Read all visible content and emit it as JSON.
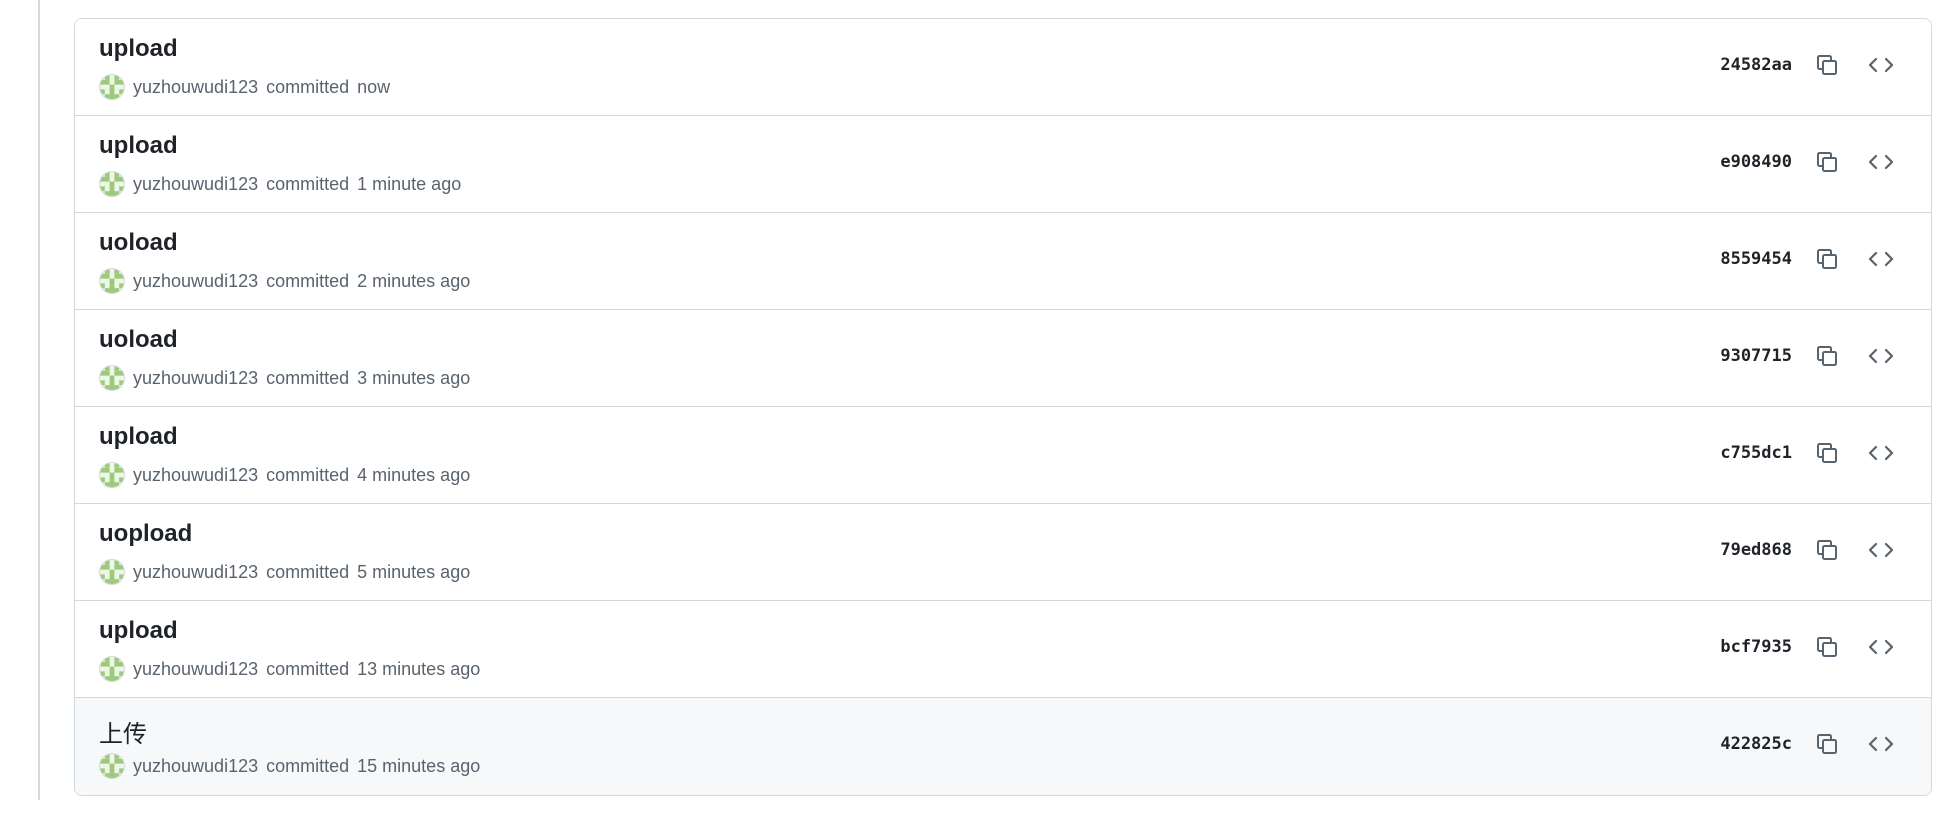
{
  "commits": [
    {
      "title": "upload",
      "author": "yuzhouwudi123",
      "action": "committed",
      "time": "now",
      "sha": "24582aa"
    },
    {
      "title": "upload",
      "author": "yuzhouwudi123",
      "action": "committed",
      "time": "1 minute ago",
      "sha": "e908490"
    },
    {
      "title": "uoload",
      "author": "yuzhouwudi123",
      "action": "committed",
      "time": "2 minutes ago",
      "sha": "8559454"
    },
    {
      "title": "uoload",
      "author": "yuzhouwudi123",
      "action": "committed",
      "time": "3 minutes ago",
      "sha": "9307715"
    },
    {
      "title": "upload",
      "author": "yuzhouwudi123",
      "action": "committed",
      "time": "4 minutes ago",
      "sha": "c755dc1"
    },
    {
      "title": "uopload",
      "author": "yuzhouwudi123",
      "action": "committed",
      "time": "5 minutes ago",
      "sha": "79ed868"
    },
    {
      "title": "upload",
      "author": "yuzhouwudi123",
      "action": "committed",
      "time": "13 minutes ago",
      "sha": "bcf7935"
    },
    {
      "title": "上传",
      "author": "yuzhouwudi123",
      "action": "committed",
      "time": "15 minutes ago",
      "sha": "422825c"
    }
  ],
  "icons": {
    "copy": "copy-icon",
    "browse": "code-icon",
    "avatar": "identicon-avatar"
  },
  "colors": {
    "border": "#d1d9e0",
    "muted_text": "#59636e",
    "hover_row": "#f6f8fa",
    "avatar_fill": "#9cc97a"
  }
}
